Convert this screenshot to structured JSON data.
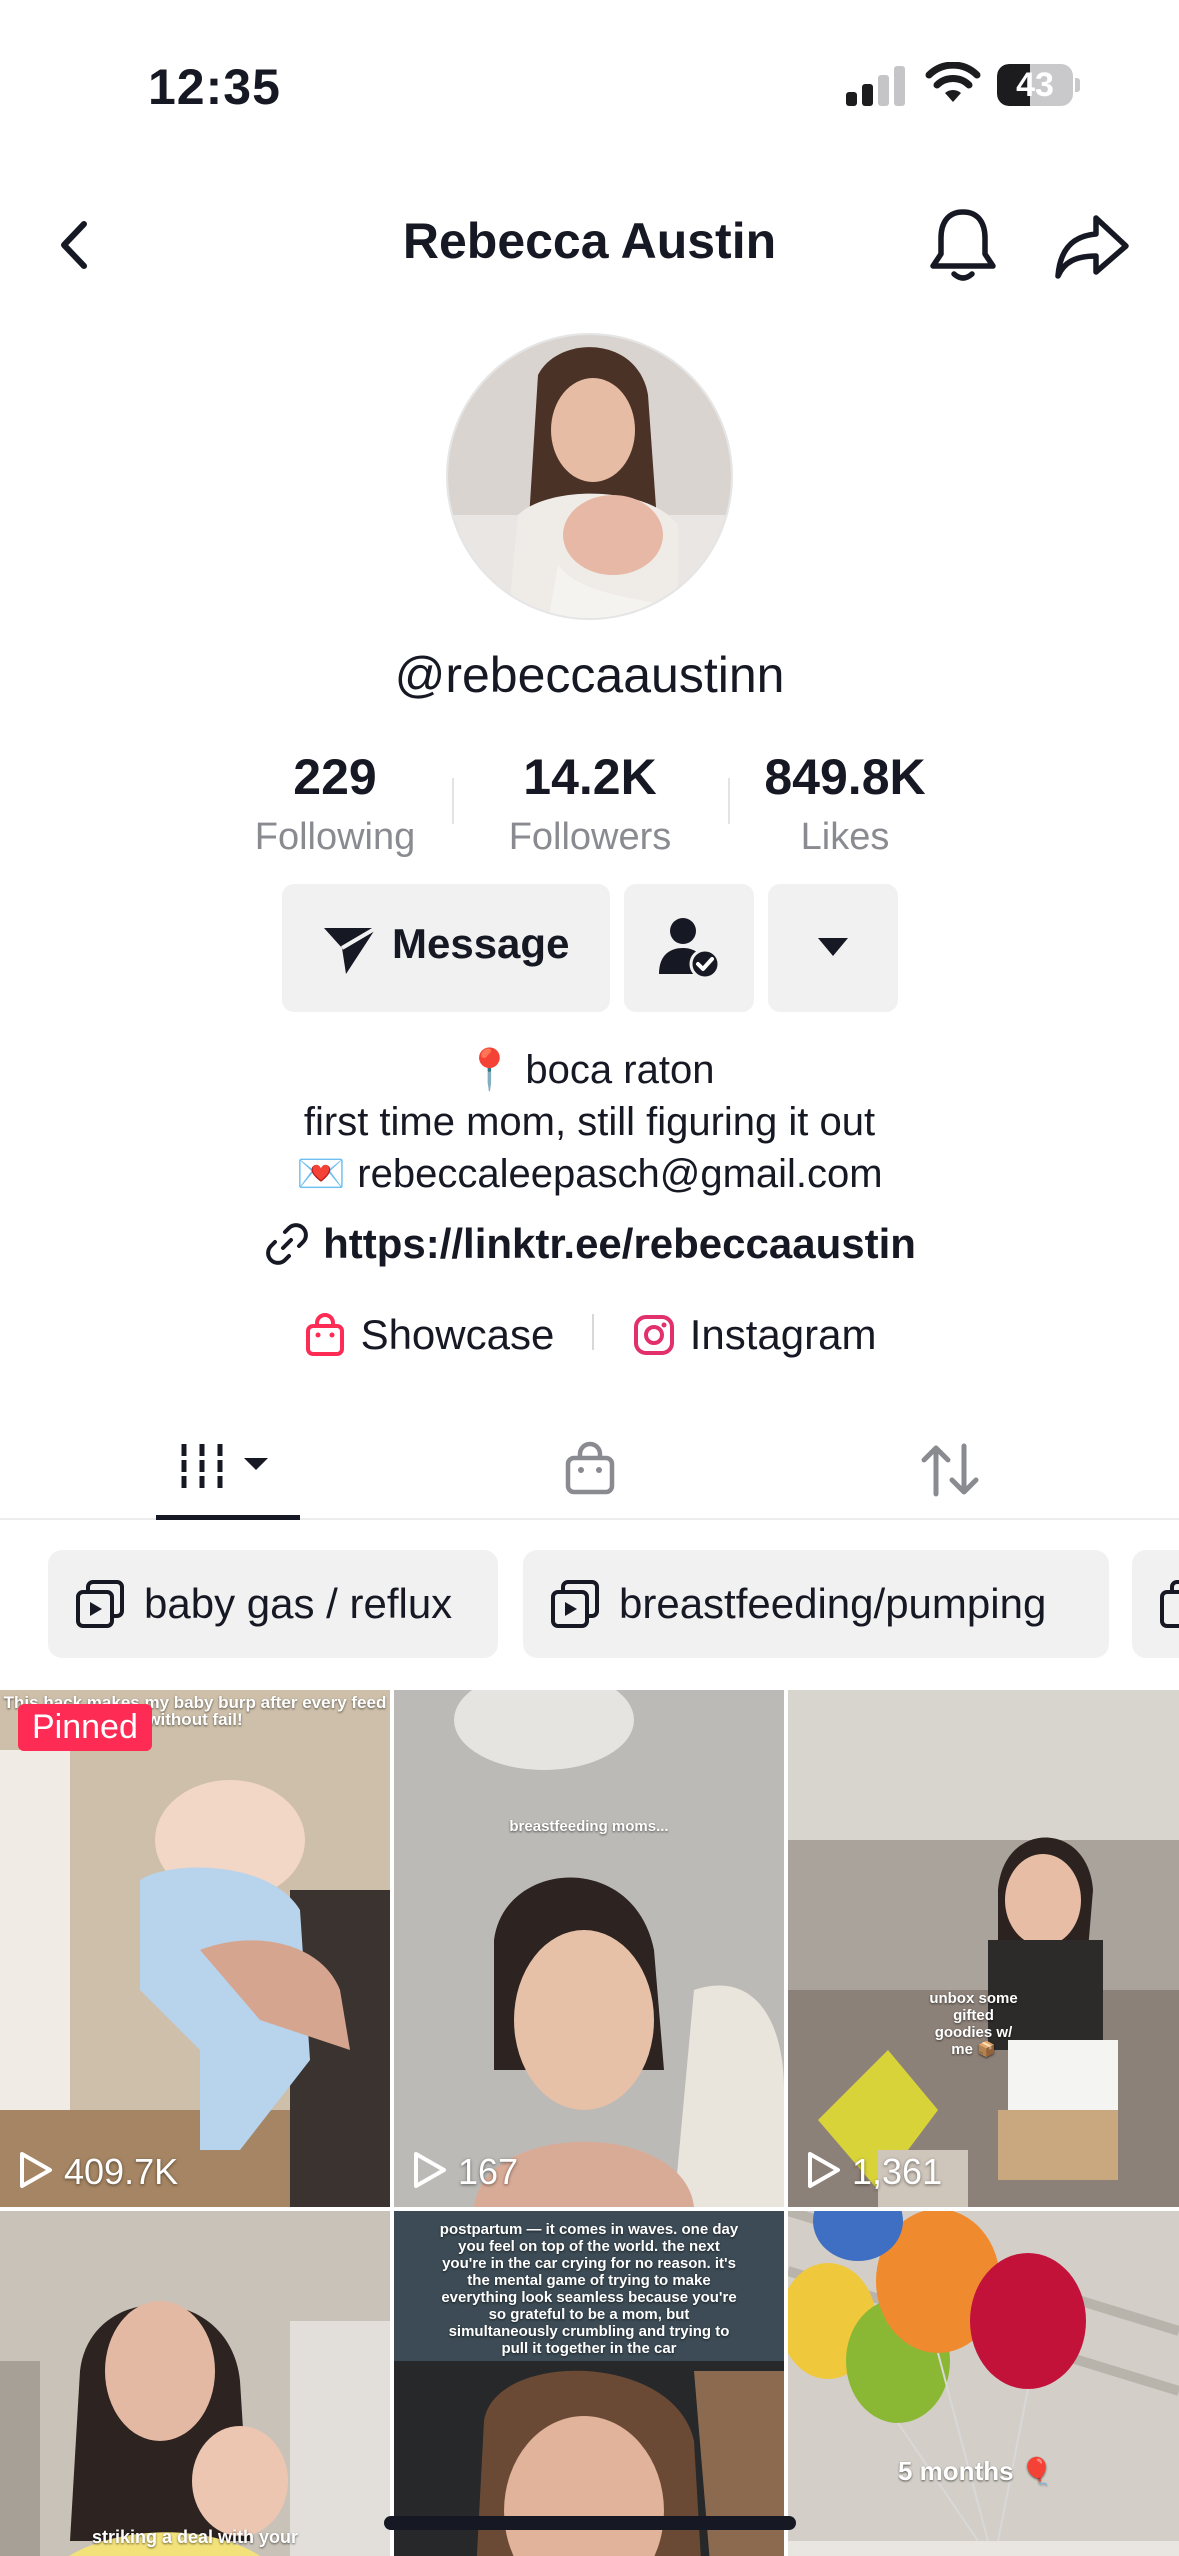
{
  "status_bar": {
    "time": "12:35",
    "battery": "43",
    "battery_level": 0.43
  },
  "header": {
    "title": "Rebecca Austin"
  },
  "profile": {
    "username": "@rebeccaaustinn",
    "stats": [
      {
        "value": "229",
        "label": "Following"
      },
      {
        "value": "14.2K",
        "label": "Followers"
      },
      {
        "value": "849.8K",
        "label": "Likes"
      }
    ],
    "buttons": {
      "message": "Message"
    },
    "bio": {
      "line1": "📍 boca raton",
      "line2": "first time mom, still figuring it out",
      "line3": "💌 rebeccaleepasch@gmail.com"
    },
    "link": "https://linktr.ee/rebeccaaustin",
    "badges": {
      "showcase": "Showcase",
      "instagram": "Instagram"
    }
  },
  "playlists": [
    {
      "label": "baby gas / reflux"
    },
    {
      "label": "breastfeeding/pumping"
    }
  ],
  "videos": [
    {
      "views": "409.7K",
      "pinned": "Pinned",
      "caption": "This hack makes my baby burp after every feed without fail!"
    },
    {
      "views": "167",
      "caption": "breastfeeding moms..."
    },
    {
      "views": "1,361",
      "caption": "unbox some gifted goodies w/ me 📦"
    },
    {
      "caption": "striking a deal with your"
    },
    {
      "caption": "postpartum — it comes in waves. one day you feel on top of the world. the next you're in the car crying for no reason. it's the mental game of trying to make everything look seamless because you're so grateful to be a mom, but simultaneously crumbling and trying to pull it together in the car"
    },
    {
      "caption": "5 months 🎈"
    }
  ],
  "colors": {
    "accent": "#fe2c55",
    "text": "#161823",
    "muted": "#8a8b91",
    "chip_bg": "#f1f1f2"
  }
}
